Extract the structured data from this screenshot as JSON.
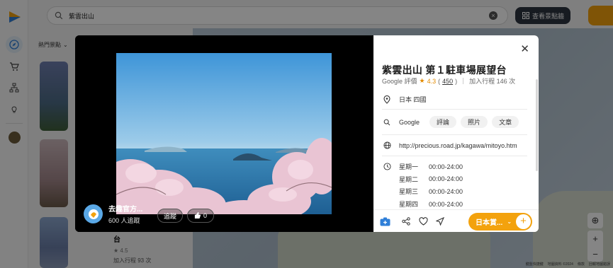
{
  "search": {
    "value": "紫雲出山",
    "placeholder": ""
  },
  "top_bar": {
    "view_spots_label": "查看景點牆"
  },
  "left_panel": {
    "filter_label": "熱門景點",
    "card": {
      "title": "台",
      "rating": "4.5",
      "added": "加入行程 93 次"
    }
  },
  "map": {
    "controls": {
      "locate": "⊕",
      "zoom_in": "+",
      "zoom_out": "−"
    },
    "footer": [
      "鍵盤快捷鍵",
      "地圖資料 ©2024",
      "條款",
      "回報地圖錯誤"
    ]
  },
  "photo": {
    "author_name": "去趣官方...",
    "followers": "600 人追蹤",
    "follow_label": "追蹤",
    "like_count": "0"
  },
  "place": {
    "title": "紫雲出山 第１駐車場展望台",
    "rating_source": "Google 評價",
    "rating_value": "4.3",
    "rating_count_open": "(",
    "rating_count": "450",
    "rating_count_close": ")",
    "added": "加入行程 146 次",
    "region": "日本 四國",
    "search_label": "Google",
    "chips": [
      "評論",
      "照片",
      "文章"
    ],
    "website": "http://precious.road.jp/kagawa/mitoyo.htm",
    "hours": [
      {
        "day": "星期一",
        "time": "00:00-24:00"
      },
      {
        "day": "星期二",
        "time": "00:00-24:00"
      },
      {
        "day": "星期三",
        "time": "00:00-24:00"
      },
      {
        "day": "星期四",
        "time": "00:00-24:00"
      }
    ],
    "add_trip_label": "日本賞..."
  },
  "colors": {
    "accent": "#f3a20d",
    "dark_button": "#2d3440",
    "star": "#e38b00",
    "primary_blue": "#2f7fd8"
  }
}
